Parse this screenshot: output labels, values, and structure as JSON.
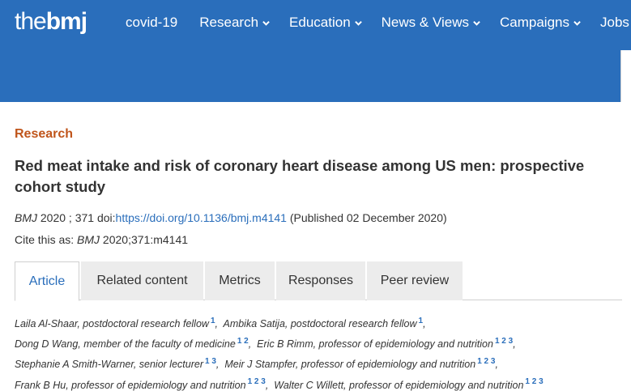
{
  "header": {
    "logo_the": "the",
    "logo_bmj": "bmj",
    "nav": [
      {
        "label": "covid-19",
        "has_chevron": false
      },
      {
        "label": "Research",
        "has_chevron": true
      },
      {
        "label": "Education",
        "has_chevron": true
      },
      {
        "label": "News & Views",
        "has_chevron": true
      },
      {
        "label": "Campaigns",
        "has_chevron": true
      },
      {
        "label": "Jobs",
        "has_chevron": true
      }
    ],
    "bg_color": "#2a6ebb"
  },
  "article": {
    "section": "Research",
    "title": "Red meat intake and risk of coronary heart disease among US men: prospective cohort study",
    "journal": "BMJ",
    "year_volume": "2020 ; 371",
    "doi_label": "doi:",
    "doi_link": "https://doi.org/10.1136/bmj.m4141",
    "published": "(Published 02 December 2020)",
    "cite_prefix": "Cite this as:",
    "cite_journal": "BMJ",
    "cite_ref": "2020;371:m4141"
  },
  "tabs": [
    {
      "label": "Article",
      "active": true
    },
    {
      "label": "Related content",
      "active": false
    },
    {
      "label": "Metrics",
      "active": false
    },
    {
      "label": "Responses",
      "active": false
    },
    {
      "label": "Peer review",
      "active": false
    }
  ],
  "authors": [
    {
      "name": "Laila Al-Shaar, postdoctoral research fellow",
      "aff": "1",
      "sep": ","
    },
    {
      "name": "Ambika Satija, postdoctoral research fellow",
      "aff": "1",
      "sep": ","
    },
    {
      "name": "Dong D Wang, member of the faculty of medicine",
      "aff": "1 2",
      "sep": ","
    },
    {
      "name": "Eric B Rimm, professor of epidemiology and nutrition",
      "aff": "1 2 3",
      "sep": ","
    },
    {
      "name": "Stephanie A Smith-Warner, senior lecturer",
      "aff": "1 3",
      "sep": ","
    },
    {
      "name": "Meir J Stampfer, professor of epidemiology and nutrition",
      "aff": "1 2 3",
      "sep": ","
    },
    {
      "name": "Frank B Hu, professor of epidemiology and nutrition",
      "aff": "1 2 3",
      "sep": ","
    },
    {
      "name": "Walter C Willett, professor of epidemiology and nutrition",
      "aff": "1 2 3",
      "sep": ""
    }
  ]
}
